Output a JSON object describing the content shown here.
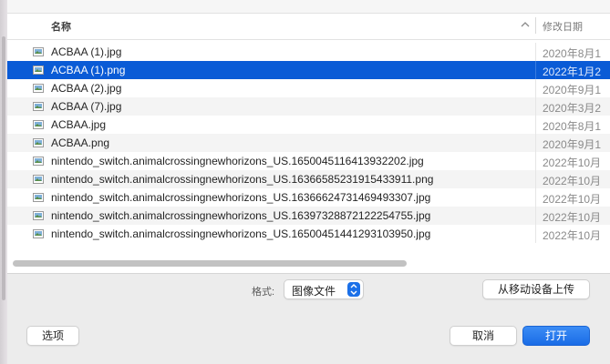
{
  "header": {
    "name_col": "名称",
    "date_col": "修改日期"
  },
  "files": [
    {
      "name": "ACBAA (1).jpg",
      "date": "2020年8月1",
      "icon": "image-file-icon",
      "selected": false
    },
    {
      "name": "ACBAA (1).png",
      "date": "2022年1月2",
      "icon": "image-file-icon",
      "selected": true
    },
    {
      "name": "ACBAA (2).jpg",
      "date": "2020年9月1",
      "icon": "image-file-icon",
      "selected": false
    },
    {
      "name": "ACBAA (7).jpg",
      "date": "2020年3月2",
      "icon": "image-file-icon",
      "selected": false
    },
    {
      "name": "ACBAA.jpg",
      "date": "2020年8月1",
      "icon": "image-file-icon",
      "selected": false
    },
    {
      "name": "ACBAA.png",
      "date": "2020年9月1",
      "icon": "image-file-icon",
      "selected": false
    },
    {
      "name": "nintendo_switch.animalcrossingnewhorizons_US.16500451164139322​02.jpg",
      "date": "2022年10月",
      "icon": "image-file-icon",
      "selected": false
    },
    {
      "name": "nintendo_switch.animalcrossingnewhorizons_US.16366585231915433911.png",
      "date": "2022年10月",
      "icon": "image-file-icon",
      "selected": false
    },
    {
      "name": "nintendo_switch.animalcrossingnewhorizons_US.16366624731469493307.jpg",
      "date": "2022年10月",
      "icon": "image-file-icon",
      "selected": false
    },
    {
      "name": "nintendo_switch.animalcrossingnewhorizons_US.16397328872122254755.jpg",
      "date": "2022年10月",
      "icon": "image-file-icon",
      "selected": false
    },
    {
      "name": "nintendo_switch.animalcrossingnewhorizons_US.16500451441293103950.jpg",
      "date": "2022年10月",
      "icon": "image-file-icon",
      "selected": false
    }
  ],
  "format": {
    "label": "格式:",
    "selected": "图像文件"
  },
  "buttons": {
    "upload": "从移动设备上传",
    "options": "选项",
    "cancel": "取消",
    "open": "打开"
  },
  "colors": {
    "selection": "#0a5bd6",
    "accent": "#1b70e8"
  }
}
